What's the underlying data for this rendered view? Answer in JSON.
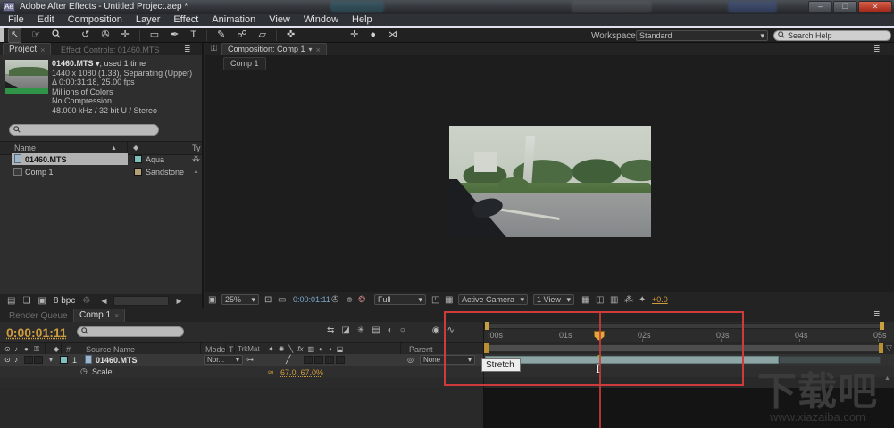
{
  "window": {
    "title": "Adobe After Effects - Untitled Project.aep *",
    "app_badge": "Ae"
  },
  "menu": {
    "items": [
      "File",
      "Edit",
      "Composition",
      "Layer",
      "Effect",
      "Animation",
      "View",
      "Window",
      "Help"
    ]
  },
  "toolbar": {
    "workspace_label": "Workspace:",
    "workspace_value": "Standard",
    "search_placeholder": "Search Help"
  },
  "project": {
    "tab": "Project",
    "tab_close": "×",
    "effect_controls_tab": "Effect Controls: 01460.MTS",
    "info": {
      "name": "01460.MTS ▾",
      "usage": ", used 1 time",
      "line2": "1440 x 1080 (1.33), Separating (Upper)",
      "line3": "Δ 0:00:31:18, 25.00 fps",
      "line4": "Millions of Colors",
      "line5": "No Compression",
      "line6": "48.000 kHz / 32 bit U / Stereo"
    },
    "columns": {
      "name": "Name",
      "type": "Ty"
    },
    "rows": [
      {
        "name": "01460.MTS",
        "label": "Aqua"
      },
      {
        "name": "Comp 1",
        "label": "Sandstone"
      }
    ],
    "footer": {
      "bpc": "8 bpc"
    }
  },
  "comp": {
    "tab": "Composition: Comp 1",
    "subtab": "Comp 1",
    "toolbar": {
      "zoom": "25%",
      "timecode": "0:00:01:11",
      "resolution": "Full",
      "view": "Active Camera",
      "layout": "1 View",
      "exposure": "+0.0"
    }
  },
  "timeline": {
    "tab_render_queue": "Render Queue",
    "tab_comp": "Comp 1",
    "tab_close": "×",
    "current_time": "0:00:01:11",
    "columns": {
      "hash": "#",
      "source_name": "Source Name",
      "mode": "Mode",
      "t": "T",
      "trkmat": "TrkMat",
      "parent": "Parent"
    },
    "layer": {
      "index": "1",
      "name": "01460.MTS",
      "mode": "Nor...",
      "parent": "None"
    },
    "property": {
      "name": "Scale",
      "value": "67.0, 67.0%"
    },
    "ruler_labels": [
      ":00s",
      "01s",
      "02s",
      "03s",
      "04s",
      "05s"
    ],
    "tooltip": "Stretch"
  },
  "watermark": {
    "text": "下载吧",
    "url": "www.xiazaiba.com"
  },
  "colors": {
    "accent_orange": "#d09c3e",
    "annotation_red": "#cf3a3a",
    "layer_bar": "#8da6a5",
    "aqua_label": "#7ec1ba",
    "sandstone_label": "#b3a175",
    "timecode_blue": "#7aa8cc"
  },
  "icons": {
    "minimize": "–",
    "maximize": "❐",
    "close": "✕",
    "selection": "↖",
    "hand": "☞",
    "rotation": "↺",
    "camera": "✇",
    "pan_behind": "✛",
    "rectangle": "▭",
    "pen": "✒",
    "type": "T",
    "brush": "✎",
    "clone_stamp": "☍",
    "eraser": "▱",
    "puppet_pin": "✜",
    "align_a": "✛",
    "align_b": "●",
    "align_c": "⋈",
    "panel_menu": "≣",
    "dropdown": "▾",
    "sort": "▲",
    "tag": "◆",
    "tree": "⁂",
    "eye": "⊙",
    "audio": "♪",
    "solo": "●",
    "lock": "⚿",
    "stopwatch": "◷",
    "link": "∞",
    "pickwhip": "◎",
    "expander": "▾",
    "comp_flowchart": "⇆",
    "draft_3d": "◪",
    "live_update": "✳",
    "frame_blend": "▤",
    "motion_blur": "◐",
    "brainstorm": "○",
    "auto_key": "◉",
    "graph_editor": "∿",
    "preview_mini": "▣",
    "safe_margins": "⊡",
    "region": "▭",
    "snapshot": "✇",
    "show_snapshot": "☻",
    "channels": "❂",
    "roi": "◳",
    "transp_grid": "▦",
    "grid_guides": "▦",
    "mask_vis": "◫",
    "render_ind": "▥",
    "flowchart": "⁂",
    "exposure_reset": "✦",
    "interpret": "▤",
    "folder": "❏",
    "new_comp": "▣",
    "trash": "♲",
    "scroll_left": "◀",
    "scroll_right": "▶",
    "scroll_up": "▲",
    "marker_bin": "▽",
    "quality": "╱",
    "motion_path": "⊶",
    "sw_shy": "✦",
    "sw_collapse": "✺",
    "sw_quality": "╲",
    "sw_fx": "fx",
    "sw_blend": "▥",
    "sw_mblur": "◐",
    "sw_adjust": "◑",
    "sw_3d": "⬓",
    "ibeam": "I"
  }
}
